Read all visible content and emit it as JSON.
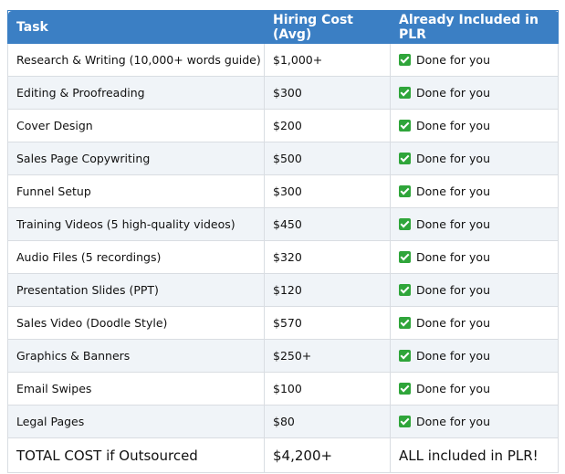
{
  "table": {
    "headers": [
      "Task",
      "Hiring Cost (Avg)",
      "Already Included in PLR"
    ],
    "rows": [
      {
        "task": "Research & Writing (10,000+ words guide)",
        "cost": "$1,000+",
        "status": "Done for you"
      },
      {
        "task": "Editing & Proofreading",
        "cost": "$300",
        "status": "Done for you"
      },
      {
        "task": "Cover Design",
        "cost": "$200",
        "status": "Done for you"
      },
      {
        "task": "Sales Page Copywriting",
        "cost": "$500",
        "status": "Done for you"
      },
      {
        "task": "Funnel Setup",
        "cost": "$300",
        "status": "Done for you"
      },
      {
        "task": "Training Videos (5 high-quality videos)",
        "cost": "$450",
        "status": "Done for you"
      },
      {
        "task": "Audio Files (5 recordings)",
        "cost": "$320",
        "status": "Done for you"
      },
      {
        "task": "Presentation Slides (PPT)",
        "cost": "$120",
        "status": "Done for you"
      },
      {
        "task": "Sales Video (Doodle Style)",
        "cost": "$570",
        "status": "Done for you"
      },
      {
        "task": "Graphics & Banners",
        "cost": "$250+",
        "status": "Done for you"
      },
      {
        "task": "Email Swipes",
        "cost": "$100",
        "status": "Done for you"
      },
      {
        "task": "Legal Pages",
        "cost": "$80",
        "status": "Done for you"
      }
    ],
    "total": {
      "label": "TOTAL COST if Outsourced",
      "cost": "$4,200+",
      "status": "ALL included in PLR!"
    }
  },
  "icons": {
    "status_icon": "green-checkmark-icon"
  },
  "colors": {
    "header_bg": "#3b7fc4",
    "check": "#2fa53a",
    "row_alt": "#f0f4f8"
  }
}
